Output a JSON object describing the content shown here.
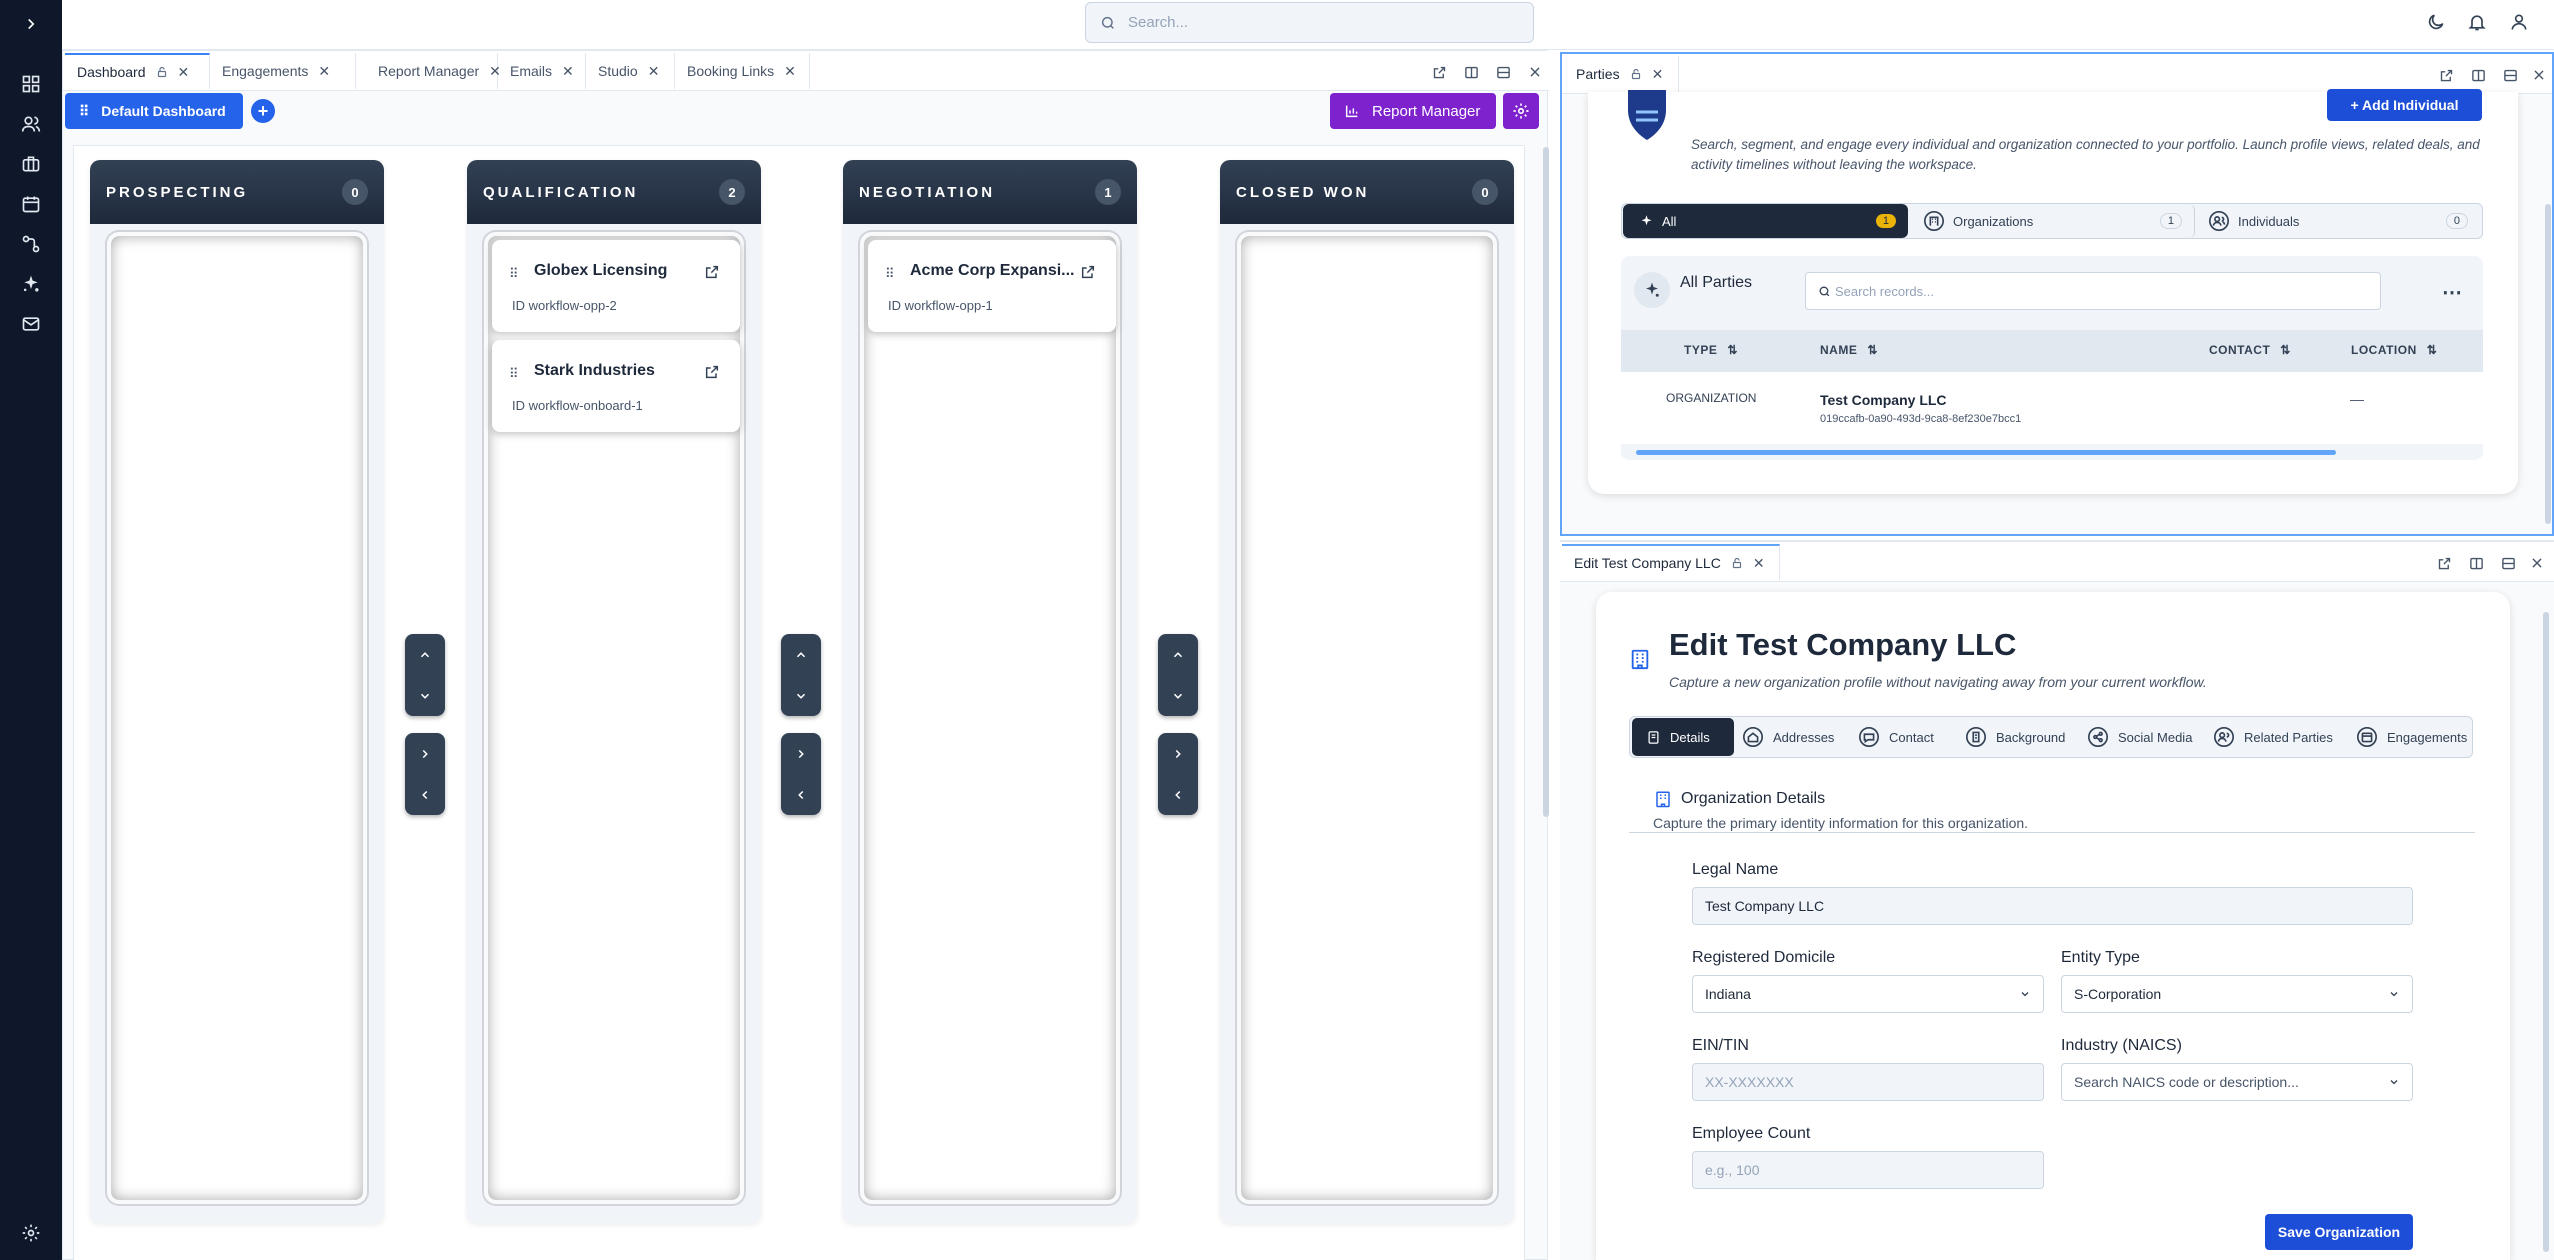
{
  "search": {
    "placeholder": "Search..."
  },
  "left_tabs": [
    {
      "label": "Dashboard"
    },
    {
      "label": "Engagements"
    },
    {
      "label": "Report Manager"
    },
    {
      "label": "Emails"
    },
    {
      "label": "Studio"
    },
    {
      "label": "Booking Links"
    }
  ],
  "dashboard": {
    "selector_label": "Default Dashboard",
    "report_button": "Report Manager"
  },
  "columns": [
    {
      "title": "PROSPECTING",
      "count": "0",
      "cards": []
    },
    {
      "title": "QUALIFICATION",
      "count": "2",
      "cards": [
        {
          "name": "Globex Licensing",
          "id": "ID workflow-opp-2"
        },
        {
          "name": "Stark Industries",
          "id": "ID workflow-onboard-1"
        }
      ]
    },
    {
      "title": "NEGOTIATION",
      "count": "1",
      "cards": [
        {
          "name": "Acme Corp Expansi...",
          "id": "ID workflow-opp-1"
        }
      ]
    },
    {
      "title": "CLOSED WON",
      "count": "0",
      "cards": []
    }
  ],
  "parties": {
    "tab_label": "Parties",
    "add_button": "+ Add Individual",
    "description": "Search, segment, and engage every individual and organization connected to your portfolio. Launch profile views, related deals, and activity timelines without leaving the workspace.",
    "filters": [
      {
        "label": "All",
        "count": "1"
      },
      {
        "label": "Organizations",
        "count": "1"
      },
      {
        "label": "Individuals",
        "count": "0"
      }
    ],
    "list_title": "All Parties",
    "search_placeholder": "Search records...",
    "columns": [
      "TYPE",
      "NAME",
      "CONTACT",
      "LOCATION"
    ],
    "rows": [
      {
        "type": "ORGANIZATION",
        "name": "Test Company LLC",
        "uuid": "019ccafb-0a90-493d-9ca8-8ef230e7bcc1",
        "location": "—"
      }
    ]
  },
  "edit": {
    "tab_label": "Edit Test Company LLC",
    "title": "Edit Test Company LLC",
    "subtitle": "Capture a new organization profile without navigating away from your current workflow.",
    "tabs": [
      "Details",
      "Addresses",
      "Contact",
      "Background",
      "Social Media",
      "Related Parties",
      "Engagements"
    ],
    "section_title": "Organization Details",
    "section_subtitle": "Capture the primary identity information for this organization.",
    "fields": {
      "legal_name_label": "Legal Name",
      "legal_name_value": "Test Company LLC",
      "domicile_label": "Registered Domicile",
      "domicile_value": "Indiana",
      "entity_label": "Entity Type",
      "entity_value": "S-Corporation",
      "ein_label": "EIN/TIN",
      "ein_placeholder": "XX-XXXXXXX",
      "industry_label": "Industry (NAICS)",
      "industry_placeholder": "Search NAICS code or description...",
      "employee_label": "Employee Count",
      "employee_placeholder": "e.g., 100"
    },
    "save_button": "Save Organization"
  },
  "colors": {
    "rail": "#0f172a",
    "primary": "#1d4ed8",
    "purple": "#7e22ce",
    "column_header": "#1e293b",
    "badge_yellow": "#eab308"
  },
  "icons": [
    "chevron-right-icon",
    "dashboard-icon",
    "users-icon",
    "briefcase-icon",
    "calendar-icon",
    "workflow-icon",
    "sparkle-icon",
    "mail-icon",
    "settings-icon",
    "moon-icon",
    "bell-icon",
    "user-icon"
  ]
}
